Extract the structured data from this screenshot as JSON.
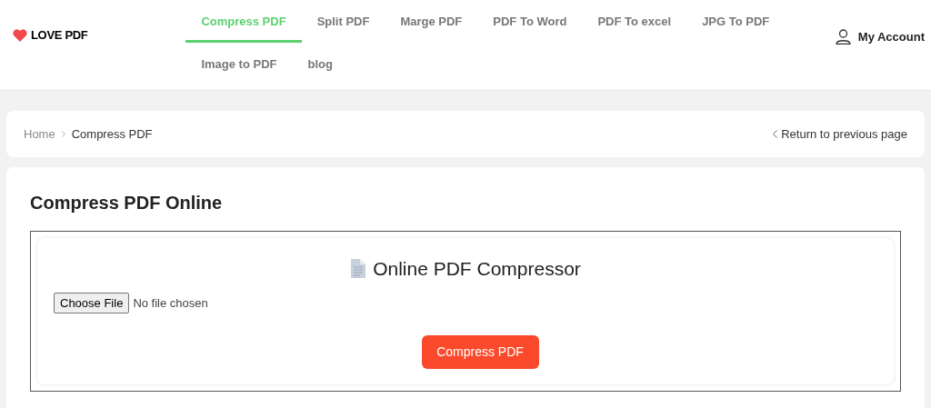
{
  "header": {
    "logo": "LOVE PDF",
    "nav": [
      {
        "label": "Compress PDF",
        "selected": true
      },
      {
        "label": "Split PDF",
        "selected": false
      },
      {
        "label": "Marge PDF",
        "selected": false
      },
      {
        "label": "PDF To Word",
        "selected": false
      },
      {
        "label": "PDF To excel",
        "selected": false
      },
      {
        "label": "JPG To PDF",
        "selected": false
      },
      {
        "label": "Image to PDF",
        "selected": false
      },
      {
        "label": "blog",
        "selected": false
      }
    ],
    "account": "My Account"
  },
  "breadcrumb": {
    "items": [
      "Home",
      "Compress PDF"
    ],
    "back": "Return to previous page"
  },
  "main": {
    "title": "Compress PDF Online",
    "tool": {
      "heading": "Online PDF Compressor",
      "file_button": "Choose File",
      "file_status": "No file chosen",
      "submit": "Compress PDF"
    }
  }
}
